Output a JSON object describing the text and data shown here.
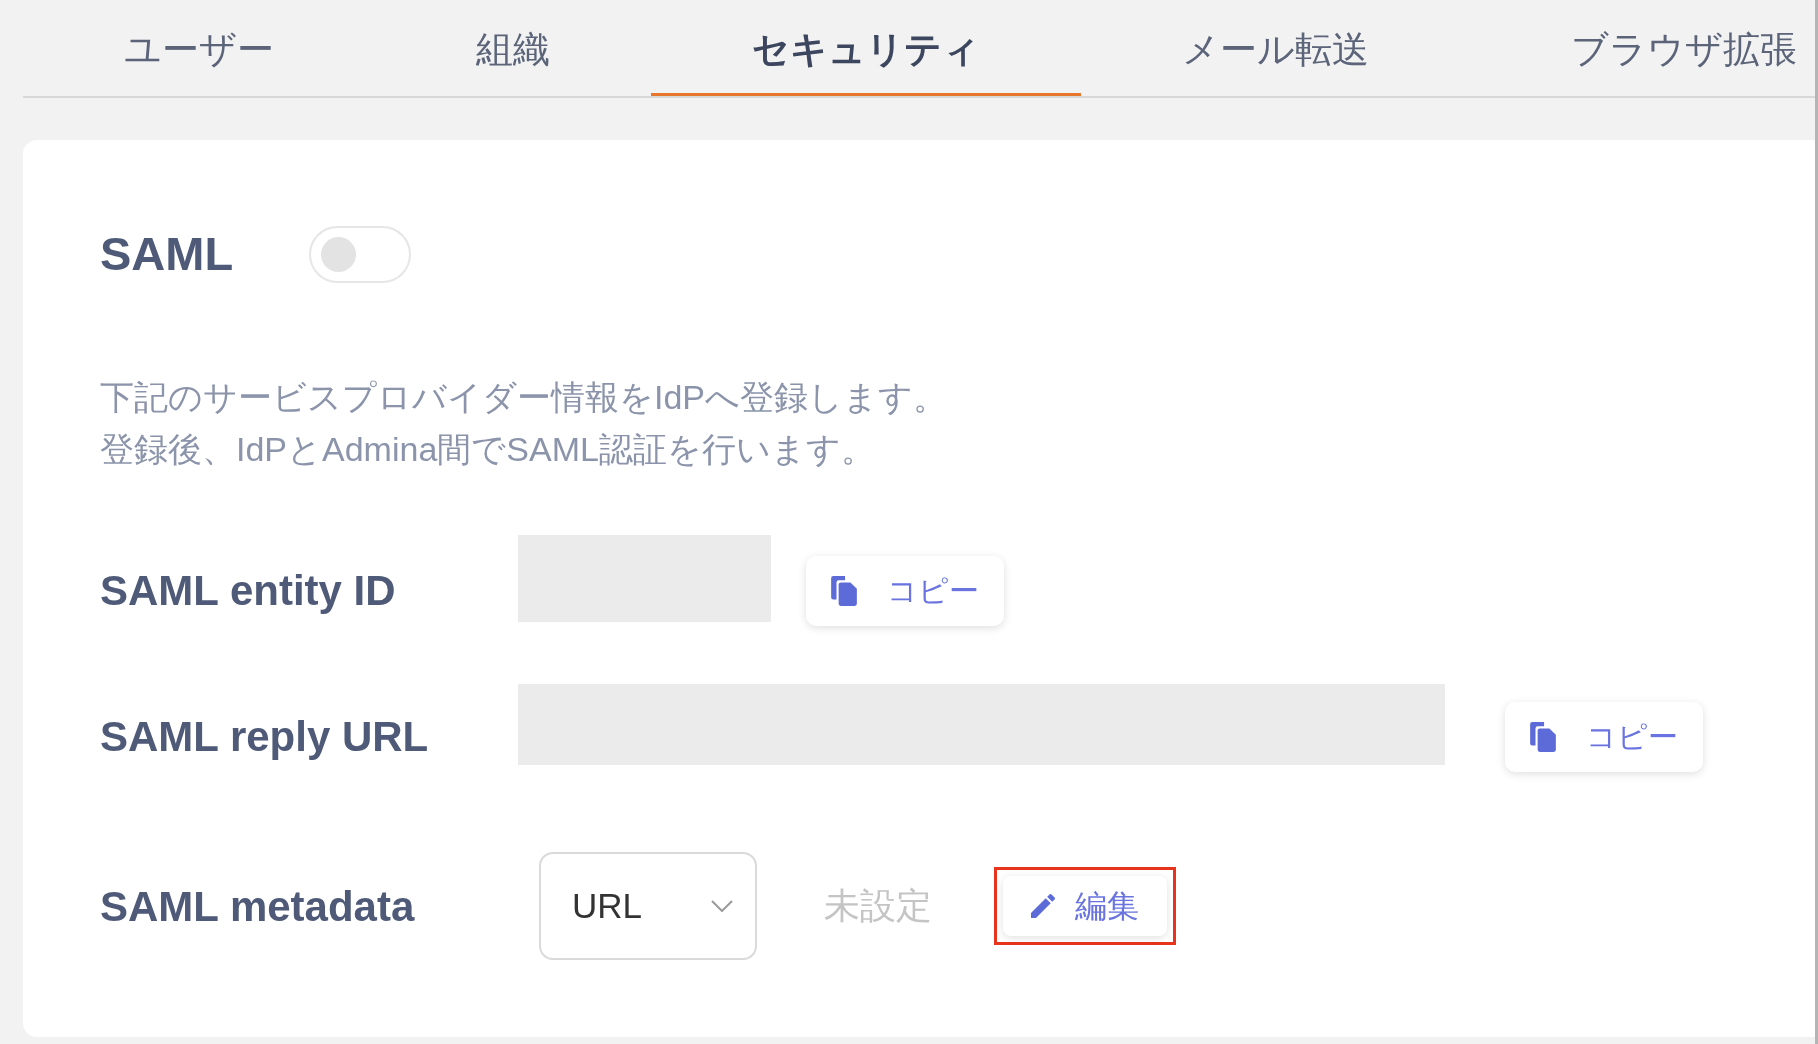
{
  "tabs": [
    {
      "label": "ユーザー",
      "selected": false
    },
    {
      "label": "組織",
      "selected": false
    },
    {
      "label": "セキュリティ",
      "selected": true
    },
    {
      "label": "メール転送",
      "selected": false
    },
    {
      "label": "ブラウザ拡張",
      "selected": false
    }
  ],
  "saml": {
    "title": "SAML",
    "enabled": false,
    "description": [
      "下記のサービスプロバイダー情報をIdPへ登録します。",
      "登録後、IdPとAdmina間でSAML認証を行います。"
    ]
  },
  "fields": [
    {
      "kind": "id",
      "label": "SAML entity ID",
      "value_masked": true,
      "copy_button": "コピー"
    },
    {
      "kind": "url",
      "label": "SAML reply URL",
      "value_masked": true,
      "copy_button": "コピー"
    }
  ],
  "metadata": {
    "label": "SAML metadata",
    "select": {
      "value": "URL"
    },
    "status": "未設定",
    "edit_button": {
      "label": "編集",
      "highlighted": true
    }
  }
}
